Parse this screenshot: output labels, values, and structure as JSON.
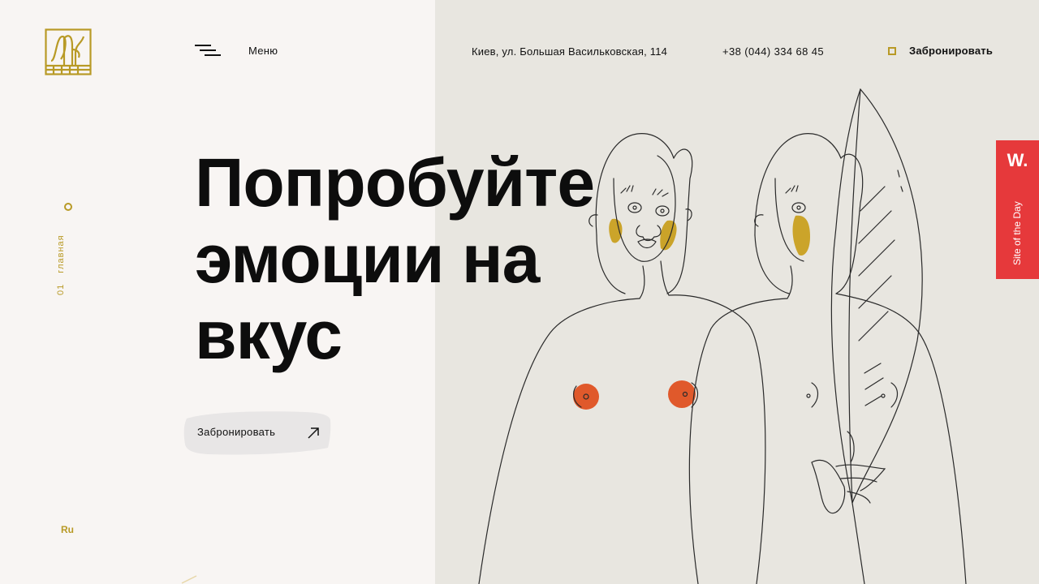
{
  "brand": {
    "logo_icon": "monogram-logo-icon",
    "accent_color": "#b89a26"
  },
  "header": {
    "menu_label": "Меню",
    "address": "Киев, ул. Большая Васильковская, 114",
    "phone": "+38 (044) 334 68 45",
    "book_label": "Забронировать"
  },
  "sidebar": {
    "section_number": "01",
    "section_label": "главная",
    "language": "Ru"
  },
  "hero": {
    "title_lines": [
      "Попробуйте",
      "эмоции на",
      "вкус"
    ],
    "cta_label": "Забронировать"
  },
  "badge": {
    "logo": "W.",
    "text": "Site of the Day",
    "color": "#e6393b"
  },
  "colors": {
    "left_bg": "#f8f5f3",
    "right_bg": "#e8e6e0",
    "orange": "#e0592b",
    "mustard": "#c9a020"
  }
}
